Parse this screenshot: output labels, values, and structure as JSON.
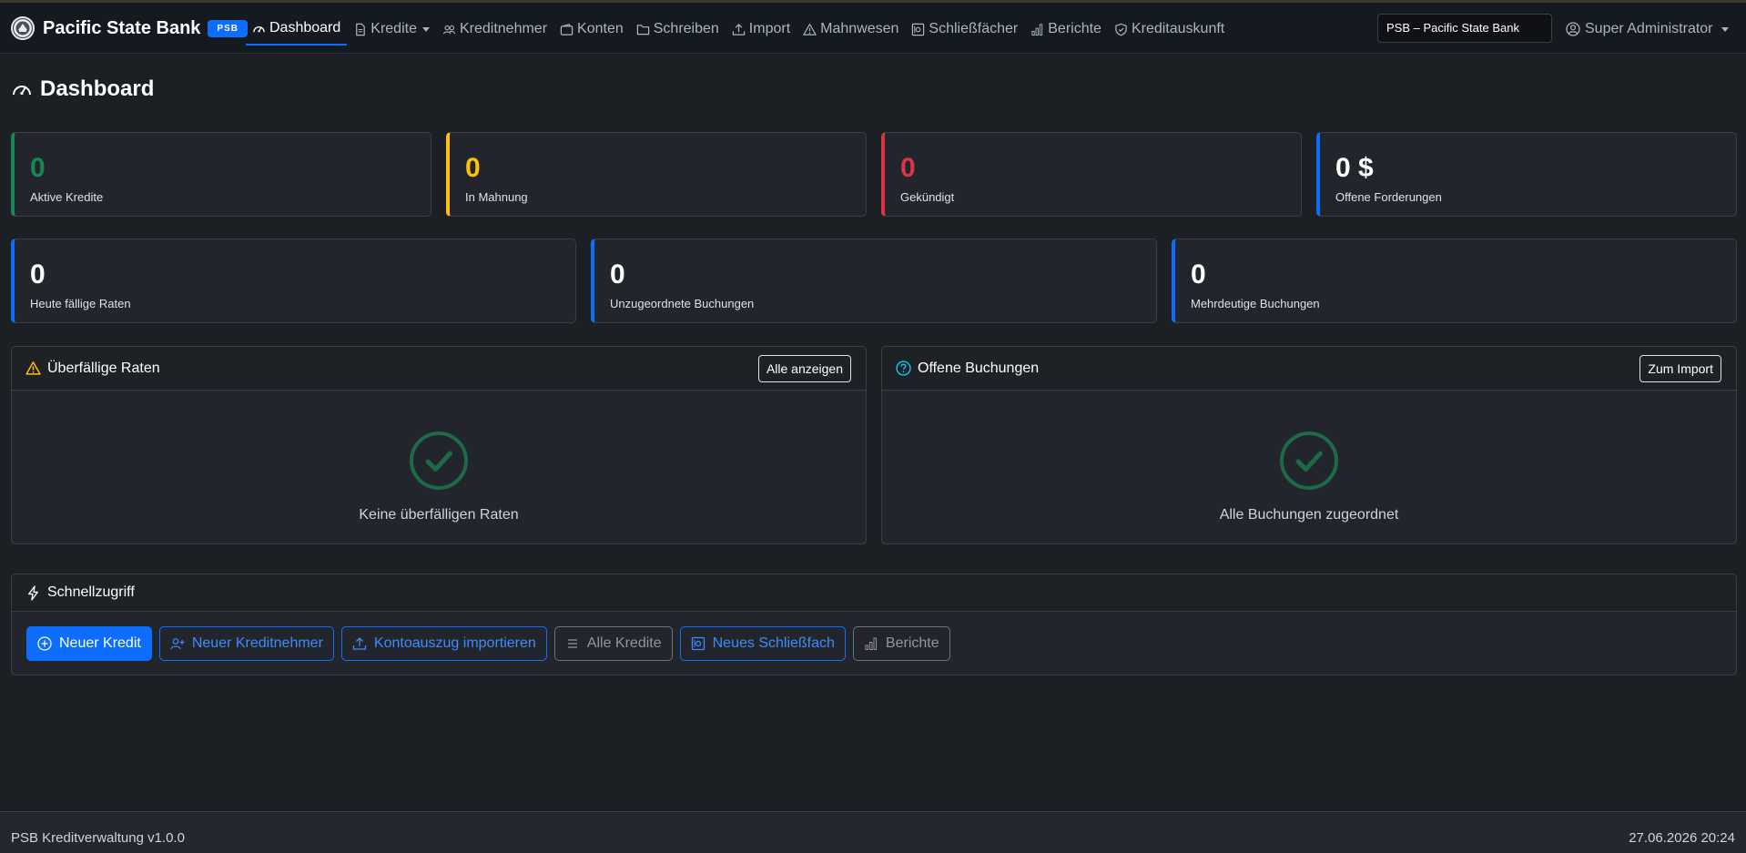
{
  "navbar": {
    "brand": "Pacific State Bank",
    "badge": "PSB",
    "items": [
      {
        "label": "Dashboard",
        "icon": "speedometer-icon",
        "active": true
      },
      {
        "label": "Kredite",
        "icon": "document-icon",
        "dropdown": true
      },
      {
        "label": "Kreditnehmer",
        "icon": "people-icon"
      },
      {
        "label": "Konten",
        "icon": "wallet-icon"
      },
      {
        "label": "Schreiben",
        "icon": "folder-icon"
      },
      {
        "label": "Import",
        "icon": "upload-icon"
      },
      {
        "label": "Mahnwesen",
        "icon": "warning-icon"
      },
      {
        "label": "Schließfächer",
        "icon": "safe-icon"
      },
      {
        "label": "Berichte",
        "icon": "bar-chart-icon"
      },
      {
        "label": "Kreditauskunft",
        "icon": "shield-check-icon"
      }
    ],
    "bank_select": "PSB – Pacific State Bank",
    "user": "Super Administrator"
  },
  "page": {
    "title": "Dashboard"
  },
  "stats_row1": [
    {
      "value": "0",
      "label": "Aktive Kredite",
      "color": "#198754"
    },
    {
      "value": "0",
      "label": "In Mahnung",
      "color": "#ffc107"
    },
    {
      "value": "0",
      "label": "Gekündigt",
      "color": "#dc3545"
    },
    {
      "value": "0 $",
      "label": "Offene Forderungen",
      "color": "#ffffff"
    }
  ],
  "stats_row2": [
    {
      "value": "0",
      "label": "Heute fällige Raten"
    },
    {
      "value": "0",
      "label": "Unzugeordnete Buchungen"
    },
    {
      "value": "0",
      "label": "Mehrdeutige Buchungen"
    }
  ],
  "overdue": {
    "title": "Überfällige Raten",
    "button": "Alle anzeigen",
    "empty": "Keine überfälligen Raten"
  },
  "bookings": {
    "title": "Offene Buchungen",
    "button": "Zum Import",
    "empty": "Alle Buchungen zugeordnet"
  },
  "quick": {
    "title": "Schnellzugriff",
    "buttons": [
      {
        "label": "Neuer Kredit",
        "icon": "plus-circle-icon"
      },
      {
        "label": "Neuer Kreditnehmer",
        "icon": "person-add-icon"
      },
      {
        "label": "Kontoauszug importieren",
        "icon": "upload-icon"
      },
      {
        "label": "Alle Kredite",
        "icon": "list-icon"
      },
      {
        "label": "Neues Schließfach",
        "icon": "safe-icon"
      },
      {
        "label": "Berichte",
        "icon": "bar-chart-icon"
      }
    ]
  },
  "footer": {
    "left": "PSB Kreditverwaltung v1.0.0",
    "right": "27.06.2026 20:24"
  }
}
